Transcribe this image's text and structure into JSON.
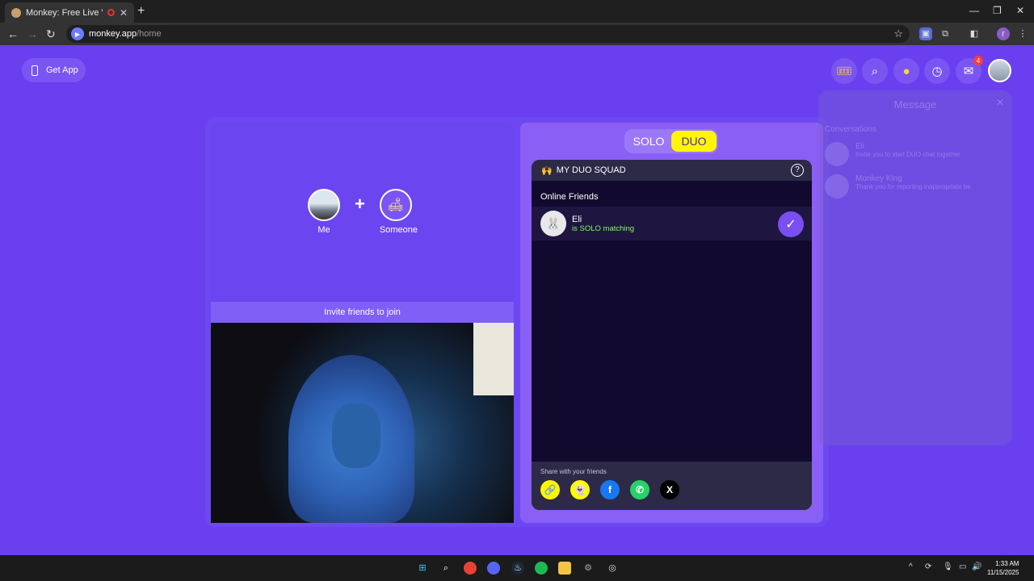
{
  "browser": {
    "tab_title": "Monkey: Free Live Video Ch",
    "new_tab_symbol": "+",
    "url_host": "monkey.app",
    "url_path": "/home"
  },
  "page": {
    "get_app_label": "Get App",
    "notification_count": "4"
  },
  "pair": {
    "me_label": "Me",
    "someone_label": "Someone",
    "plus_symbol": "+",
    "invite_label": "Invite friends to join"
  },
  "mode_toggle": {
    "solo_label": "SOLO",
    "duo_label": "DUO",
    "active": "DUO"
  },
  "squad": {
    "header_emoji": "🙌",
    "header_label": "MY DUO SQUAD",
    "online_friends_label": "Online Friends",
    "friends": [
      {
        "name": "Eli",
        "status": "is SOLO matching"
      }
    ],
    "share_label": "Share with your friends",
    "share_icons": [
      "link-icon",
      "snapchat-icon",
      "facebook-icon",
      "whatsapp-icon",
      "x-icon"
    ]
  },
  "message_panel": {
    "title": "Message",
    "conversations_label": "Conversations",
    "items": [
      {
        "name": "Eli",
        "preview": "Invite you to start DUO chat together"
      },
      {
        "name": "Monkey King",
        "preview": "Thank you for reporting inappropriate be"
      }
    ]
  },
  "taskbar": {
    "time": "1:33 AM",
    "date": "11/15/2025"
  },
  "colors": {
    "page_bg": "#6a3ff0",
    "duo_active": "#fff600",
    "status_green": "#7dff5c",
    "check_purple": "#7a4ff2"
  }
}
